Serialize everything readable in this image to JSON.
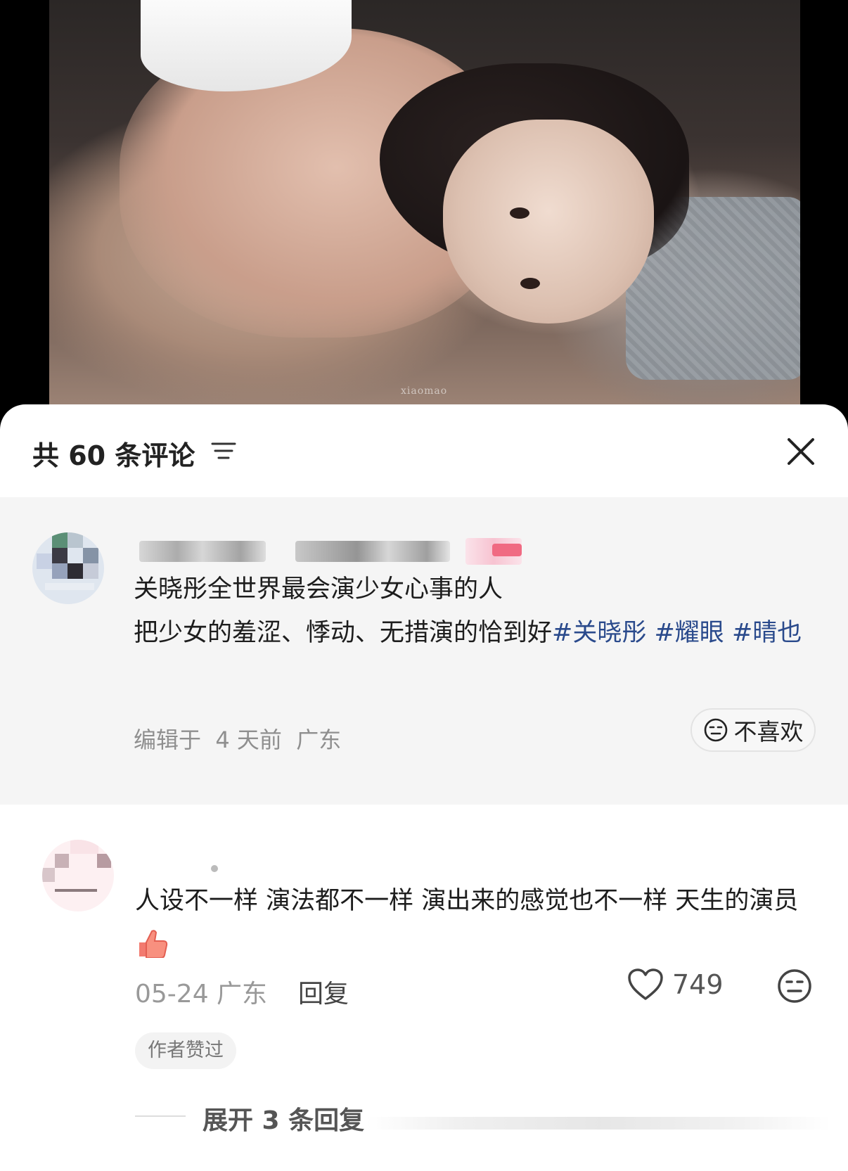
{
  "photo": {
    "watermark": "xiaomao"
  },
  "comments_sheet": {
    "title": "共 60 条评论",
    "sort_icon": "filter-lines-icon",
    "close_icon": "close-icon"
  },
  "highlighted_comment": {
    "text_line1": "关晓彤全世界最会演少女心事的人",
    "text_line2": "把少女的羞涩、悸动、无措演的恰到好",
    "tags": [
      "#关晓彤",
      "#耀眼",
      "#晴也"
    ],
    "meta": "编辑于  4 天前  广东",
    "dislike_label": "不喜欢",
    "dislike_icon": "neutral-face-icon"
  },
  "comment_2": {
    "text": "人设不一样 演法都不一样 演出来的感觉也不一样 天生的演员",
    "emoji": "thumbs-up-icon",
    "date": "05-24 广东",
    "reply_label": "回复",
    "like_count": "749",
    "like_icon": "heart-outline-icon",
    "dislike_icon": "neutral-face-icon",
    "author_badge": "作者赞过",
    "expand_label": "展开 3 条回复"
  }
}
